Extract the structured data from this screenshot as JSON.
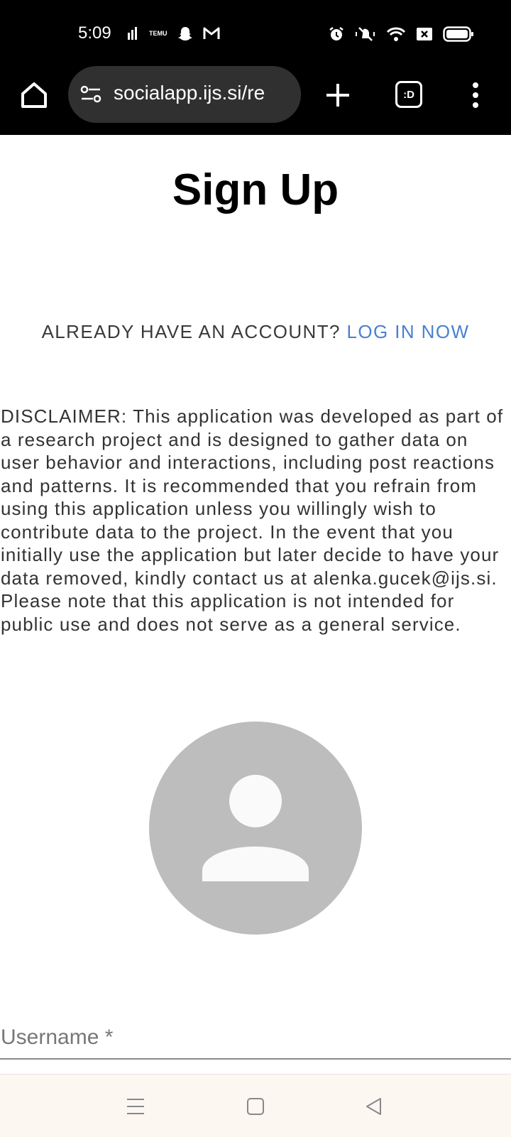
{
  "status_bar": {
    "time": "5:09",
    "left_icons": [
      "signal-sim-icon",
      "temu-icon",
      "snapchat-icon",
      "gmail-icon"
    ],
    "temu_text": "TEMU",
    "right_icons": [
      "alarm-icon",
      "mute-vibrate-icon",
      "wifi-icon",
      "no-sim-icon",
      "battery-icon"
    ]
  },
  "browser": {
    "url": "socialapp.ijs.si/re",
    "tab_count_label": ":D"
  },
  "page": {
    "title": "Sign Up",
    "already_text": "ALREADY HAVE AN ACCOUNT?",
    "login_link": "LOG IN NOW",
    "disclaimer": "DISCLAIMER: This application was developed as part of a research project and is designed to gather data on user behavior and interactions, including post reactions and patterns. It is recommended that you refrain from using this application unless you willingly wish to contribute data to the project. In the event that you initially use the application but later decide to have your data removed, kindly contact us at alenka.gucek@ijs.si. Please note that this application is not intended for public use and does not serve as a general service.",
    "username_label": "Username *"
  },
  "colors": {
    "link": "#4a80d0",
    "avatar_bg": "#bdbdbd",
    "avatar_fg": "#fafafa"
  }
}
